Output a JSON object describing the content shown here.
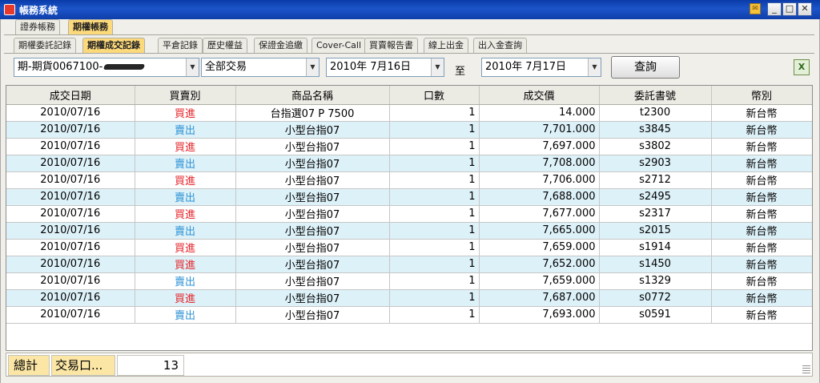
{
  "window": {
    "title": "帳務系統",
    "tray_icon_name": "notification-icon",
    "min_glyph": "_",
    "max_glyph": "□",
    "close_glyph": "✕"
  },
  "top_tabs": [
    {
      "label": "證券帳務",
      "active": false
    },
    {
      "label": "期權帳務",
      "active": true
    }
  ],
  "sub_tabs": [
    {
      "label": "期權委託記錄",
      "active": false
    },
    {
      "label": "期權成交記錄",
      "active": true
    },
    {
      "label": "平倉記錄",
      "active": false
    },
    {
      "label": "歷史權益",
      "active": false
    },
    {
      "label": "保證金追繳",
      "active": false
    },
    {
      "label": "Cover-Call",
      "active": false
    },
    {
      "label": "買賣報告書",
      "active": false
    },
    {
      "label": "線上出金",
      "active": false
    },
    {
      "label": "出入金查詢",
      "active": false
    }
  ],
  "filters": {
    "account": "期-期貨0067100-",
    "trade_type": "全部交易",
    "date_from": "2010年  7月16日",
    "to_label": "至",
    "date_to": "2010年  7月17日",
    "query_label": "查詢",
    "export_icon": "excel-export-icon"
  },
  "table": {
    "headers": [
      "成交日期",
      "買賣別",
      "商品名稱",
      "口數",
      "成交價",
      "委託書號",
      "幣別"
    ],
    "rows": [
      [
        "2010/07/16",
        "買進",
        "台指選07 P 7500",
        "1",
        "14.000",
        "t2300",
        "新台幣"
      ],
      [
        "2010/07/16",
        "賣出",
        "小型台指07",
        "1",
        "7,701.000",
        "s3845",
        "新台幣"
      ],
      [
        "2010/07/16",
        "買進",
        "小型台指07",
        "1",
        "7,697.000",
        "s3802",
        "新台幣"
      ],
      [
        "2010/07/16",
        "賣出",
        "小型台指07",
        "1",
        "7,708.000",
        "s2903",
        "新台幣"
      ],
      [
        "2010/07/16",
        "買進",
        "小型台指07",
        "1",
        "7,706.000",
        "s2712",
        "新台幣"
      ],
      [
        "2010/07/16",
        "賣出",
        "小型台指07",
        "1",
        "7,688.000",
        "s2495",
        "新台幣"
      ],
      [
        "2010/07/16",
        "買進",
        "小型台指07",
        "1",
        "7,677.000",
        "s2317",
        "新台幣"
      ],
      [
        "2010/07/16",
        "賣出",
        "小型台指07",
        "1",
        "7,665.000",
        "s2015",
        "新台幣"
      ],
      [
        "2010/07/16",
        "買進",
        "小型台指07",
        "1",
        "7,659.000",
        "s1914",
        "新台幣"
      ],
      [
        "2010/07/16",
        "買進",
        "小型台指07",
        "1",
        "7,652.000",
        "s1450",
        "新台幣"
      ],
      [
        "2010/07/16",
        "賣出",
        "小型台指07",
        "1",
        "7,659.000",
        "s1329",
        "新台幣"
      ],
      [
        "2010/07/16",
        "買進",
        "小型台指07",
        "1",
        "7,687.000",
        "s0772",
        "新台幣"
      ],
      [
        "2010/07/16",
        "賣出",
        "小型台指07",
        "1",
        "7,693.000",
        "s0591",
        "新台幣"
      ]
    ]
  },
  "summary": {
    "total_label": "總計",
    "lots_label": "交易口...",
    "lots_value": "13"
  },
  "colors": {
    "buy": "#e5262c",
    "sell": "#2f93d6",
    "active_tab": "#fcd97a",
    "alt_row": "#ddf1f8"
  }
}
